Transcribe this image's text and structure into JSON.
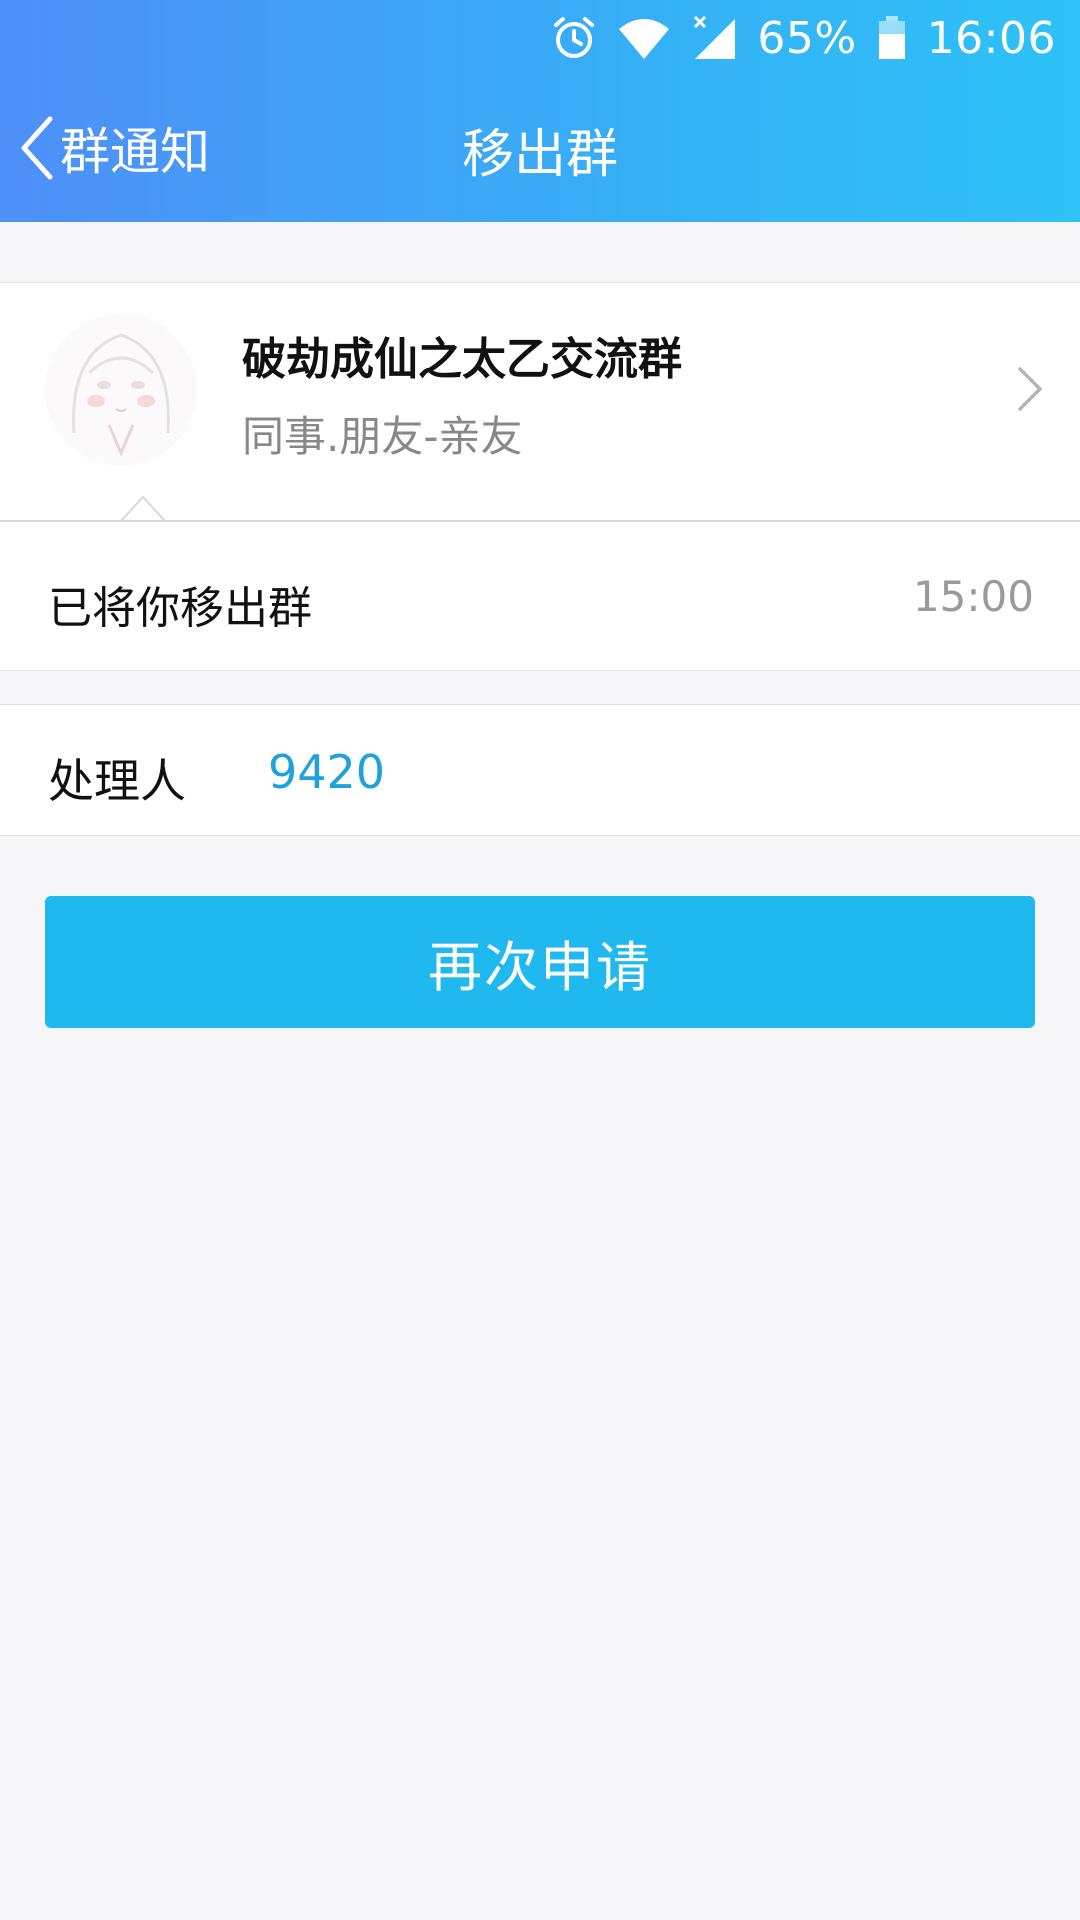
{
  "status_bar": {
    "battery_percent": "65%",
    "time": "16:06",
    "icons": [
      "alarm-icon",
      "wifi-icon",
      "cell-signal-icon",
      "battery-icon"
    ]
  },
  "nav": {
    "back_label": "群通知",
    "title": "移出群"
  },
  "group": {
    "name": "破劫成仙之太乙交流群",
    "category": "同事.朋友-亲友"
  },
  "notice": {
    "text": "已将你移出群",
    "time": "15:00"
  },
  "handler": {
    "label": "处理人",
    "value": "9420"
  },
  "action": {
    "reapply_label": "再次申请"
  },
  "colors": {
    "header_start": "#4f8ff8",
    "header_end": "#2ec2f7",
    "button": "#1fb9ef",
    "handler_link": "#1fa1dc"
  }
}
